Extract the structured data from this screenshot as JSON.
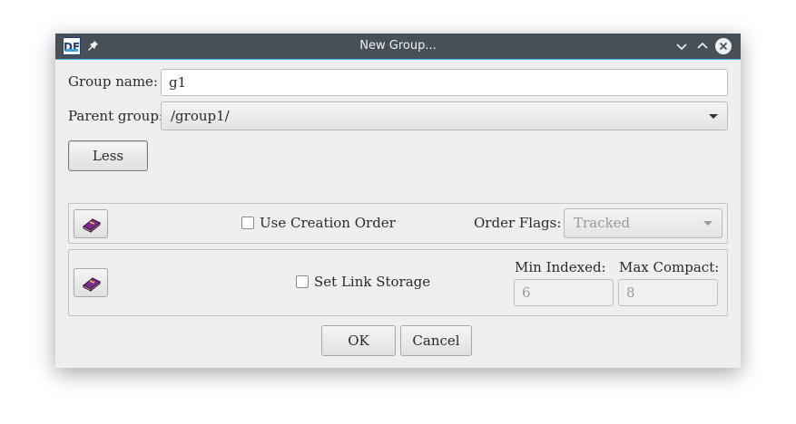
{
  "window": {
    "title": "New Group..."
  },
  "form": {
    "group_name_label": "Group name:",
    "group_name_value": "g1",
    "parent_group_label": "Parent group:",
    "parent_group_value": "/group1/",
    "less_button": "Less"
  },
  "creation_order": {
    "checkbox_label": "Use Creation Order",
    "checked": false,
    "order_flags_label": "Order Flags:",
    "order_flags_value": "Tracked"
  },
  "link_storage": {
    "checkbox_label": "Set Link Storage",
    "checked": false,
    "min_indexed_label": "Min Indexed:",
    "min_indexed_value": "6",
    "max_compact_label": "Max Compact:",
    "max_compact_value": "8"
  },
  "buttons": {
    "ok": "OK",
    "cancel": "Cancel"
  },
  "colors": {
    "titlebar": "#475057",
    "accent": "#3daee9",
    "close_button": "#eff0f1"
  },
  "icons": [
    "app-icon",
    "pin-icon",
    "minimize-icon",
    "maximize-icon",
    "close-icon",
    "help-book-icon"
  ]
}
